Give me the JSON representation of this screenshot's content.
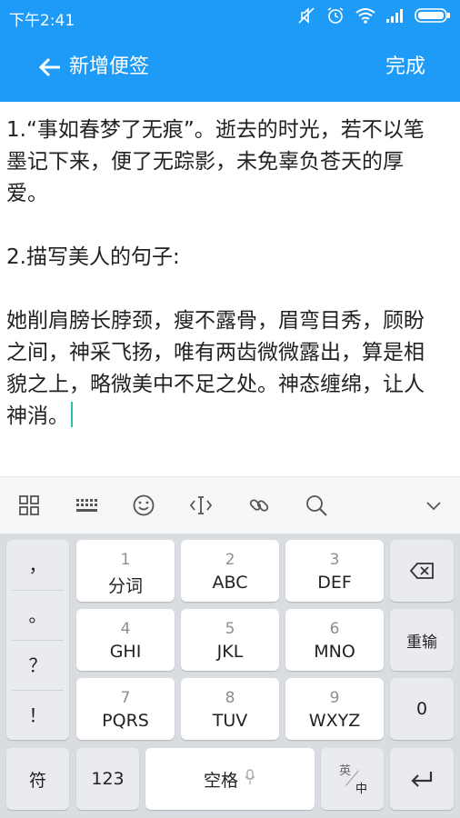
{
  "status_bar": {
    "time": "下午2:41"
  },
  "app_bar": {
    "title": "新增便签",
    "done_label": "完成"
  },
  "note": {
    "paragraphs": [
      "1.“事如春梦了无痕”。逝去的时光，若不以笔\n墨记下来，便了无踪影，未免辜负苍天的厚\n爱。",
      "2.描写美人的句子:",
      "她削肩膀长脖颈，瘦不露骨，眉弯目秀，顾盼\n之间，神采飞扬，唯有两齿微微露出，算是相\n貌之上，略微美中不足之处。神态缠绵，让人\n神消。"
    ]
  },
  "keyboard": {
    "punctuation": [
      "，",
      "。",
      "？",
      "！"
    ],
    "keys_row1": [
      {
        "num": "1",
        "label": "分词"
      },
      {
        "num": "2",
        "label": "ABC"
      },
      {
        "num": "3",
        "label": "DEF"
      }
    ],
    "keys_row2": [
      {
        "num": "4",
        "label": "GHI"
      },
      {
        "num": "5",
        "label": "JKL"
      },
      {
        "num": "6",
        "label": "MNO"
      }
    ],
    "keys_row3": [
      {
        "num": "7",
        "label": "PQRS"
      },
      {
        "num": "8",
        "label": "TUV"
      },
      {
        "num": "9",
        "label": "WXYZ"
      }
    ],
    "reinput_label": "重输",
    "zero_label": "0",
    "symbol_label": "符",
    "numeric_label": "123",
    "space_label": "空格",
    "lang_top": "英",
    "lang_bottom": "中"
  },
  "colors": {
    "accent": "#1e9bf7",
    "cursor": "#2cc1a2"
  }
}
